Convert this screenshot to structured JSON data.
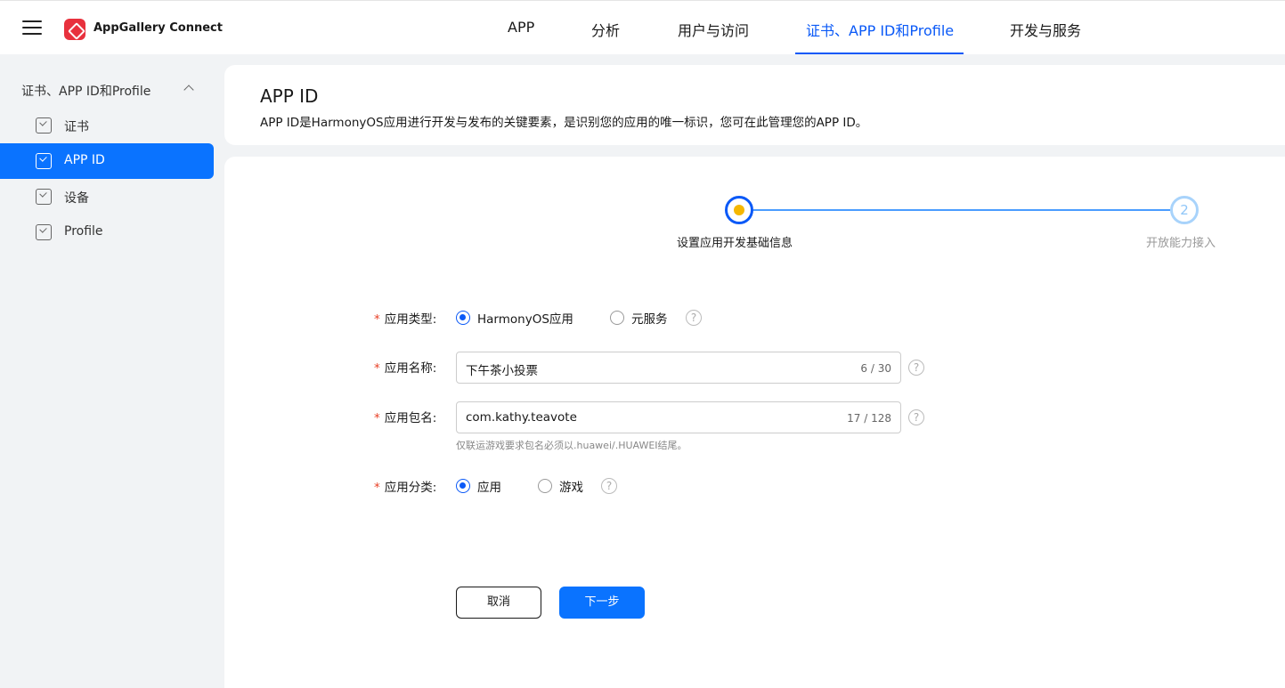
{
  "header": {
    "brand": "AppGallery Connect",
    "nav": [
      {
        "label": "APP",
        "active": false
      },
      {
        "label": "分析",
        "active": false
      },
      {
        "label": "用户与访问",
        "active": false
      },
      {
        "label": "证书、APP ID和Profile",
        "active": true
      },
      {
        "label": "开发与服务",
        "active": false
      }
    ]
  },
  "sidebar": {
    "group": "证书、APP ID和Profile",
    "items": [
      {
        "label": "证书",
        "active": false
      },
      {
        "label": "APP ID",
        "active": true
      },
      {
        "label": "设备",
        "active": false
      },
      {
        "label": "Profile",
        "active": false
      }
    ]
  },
  "page": {
    "title": "APP ID",
    "description": "APP ID是HarmonyOS应用进行开发与发布的关键要素，是识别您的应用的唯一标识，您可在此管理您的APP ID。"
  },
  "stepper": {
    "step1": {
      "label": "设置应用开发基础信息"
    },
    "step2": {
      "number": "2",
      "label": "开放能力接入"
    }
  },
  "form": {
    "required_mark": "*",
    "help_glyph": "?",
    "app_type": {
      "label": "应用类型:",
      "options": [
        {
          "label": "HarmonyOS应用",
          "checked": true
        },
        {
          "label": "元服务",
          "checked": false
        }
      ]
    },
    "app_name": {
      "label": "应用名称:",
      "value": "下午茶小投票",
      "counter": "6 / 30"
    },
    "package_name": {
      "label": "应用包名:",
      "value": "com.kathy.teavote",
      "counter": "17 / 128",
      "hint": "仅联运游戏要求包名必须以.huawei/.HUAWEI结尾。"
    },
    "category": {
      "label": "应用分类:",
      "options": [
        {
          "label": "应用",
          "checked": true
        },
        {
          "label": "游戏",
          "checked": false
        }
      ]
    }
  },
  "buttons": {
    "cancel": "取消",
    "next": "下一步"
  },
  "colors": {
    "accent": "#0a59f7",
    "primary_button": "#0a73ff",
    "required": "#e84026",
    "step_dot": "#f5b700"
  }
}
